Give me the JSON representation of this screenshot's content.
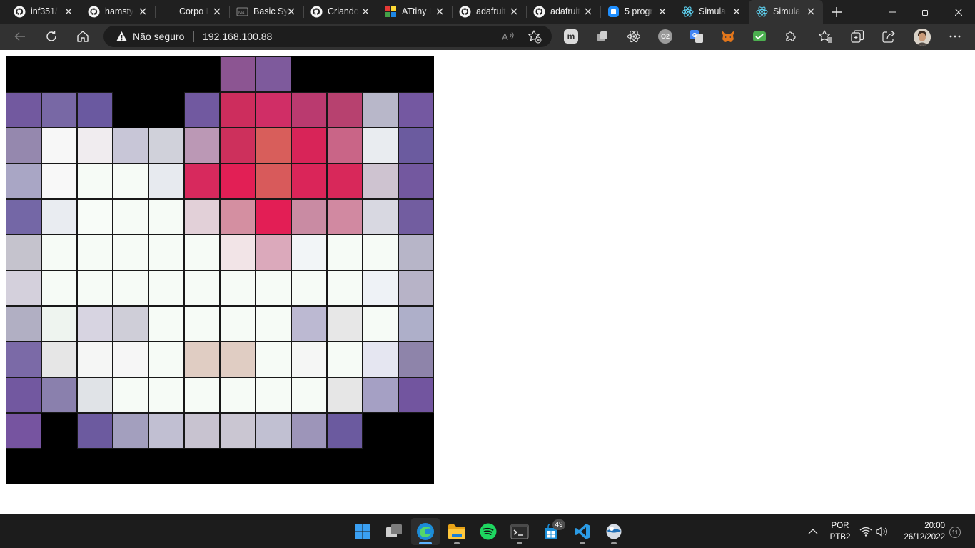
{
  "browser": {
    "tabs": [
      {
        "title": "inf351/",
        "icon": "github-icon",
        "active": false
      },
      {
        "title": "hamsty",
        "icon": "github-icon",
        "active": false
      },
      {
        "title": "Corpo I",
        "icon": "blank-page-icon",
        "active": false
      },
      {
        "title": "Basic Sy",
        "icon": "tinkercad-icon",
        "active": false
      },
      {
        "title": "Criando",
        "icon": "github-icon",
        "active": false
      },
      {
        "title": "ATtiny I",
        "icon": "attiny-icon",
        "active": false
      },
      {
        "title": "adafruit",
        "icon": "github-icon",
        "active": false
      },
      {
        "title": "adafruit",
        "icon": "github-icon",
        "active": false
      },
      {
        "title": "5 progr",
        "icon": "microsoft-icon",
        "active": false
      },
      {
        "title": "Simula",
        "icon": "react-icon",
        "active": false
      },
      {
        "title": "Simula",
        "icon": "react-icon",
        "active": true
      }
    ],
    "new_tab_icon": "plus-icon",
    "window_controls": [
      "minimize-icon",
      "restore-icon",
      "close-icon"
    ],
    "nav": {
      "back": "back-arrow-icon",
      "reload": "reload-icon",
      "home": "home-icon"
    },
    "address": {
      "security_icon": "warning-triangle-icon",
      "security_label": "Não seguro",
      "url": "192.168.100.88",
      "read_aloud_icon": "read-aloud-icon",
      "favorite_add_icon": "add-favorite-icon"
    },
    "extensions": [
      "mastodon-icon",
      "collections-ext-icon",
      "react-devtools-icon",
      "o2-icon",
      "google-translate-icon",
      "metamask-icon",
      "check-ext-icon",
      "extensions-puzzle-icon"
    ],
    "right_toolbar": [
      "favorites-icon",
      "collections-icon",
      "share-icon",
      "profile-avatar",
      "more-menu-icon"
    ]
  },
  "led_matrix": {
    "cols": 12,
    "rows": 12,
    "off_color": "#000000",
    "pixels": [
      [
        "#000000",
        "#000000",
        "#000000",
        "#000000",
        "#000000",
        "#000000",
        "#8c5592",
        "#7e5a9c",
        "#000000",
        "#000000",
        "#000000",
        "#000000"
      ],
      [
        "#72599f",
        "#7868a5",
        "#6a59a0",
        "#000000",
        "#000000",
        "#7159a0",
        "#cd2d5d",
        "#d02e66",
        "#ba3a6f",
        "#b7416f",
        "#b8b7c9",
        "#7458a1"
      ],
      [
        "#9588ae",
        "#f7f7f7",
        "#f0ecef",
        "#c8c6d7",
        "#d0d1da",
        "#bb98b5",
        "#cd305c",
        "#d85e5b",
        "#d82458",
        "#c96587",
        "#e9ecf0",
        "#6b5b9f"
      ],
      [
        "#a9a6c5",
        "#f8f8f8",
        "#f6fbf6",
        "#f6fbf6",
        "#e7eaef",
        "#d7295d",
        "#e21f55",
        "#d85a5b",
        "#da2559",
        "#d8285a",
        "#cec3d0",
        "#73589f"
      ],
      [
        "#7467a6",
        "#e9ecf1",
        "#f8fcf8",
        "#f6fbf6",
        "#f6fbf6",
        "#e2d0d8",
        "#d48fa1",
        "#e31e55",
        "#c98ba3",
        "#d189a1",
        "#d8d8e1",
        "#725da0"
      ],
      [
        "#c5c3cd",
        "#f6fbf6",
        "#f6fbf6",
        "#f6fbf6",
        "#f6fbf6",
        "#f6fbf6",
        "#f2e4e7",
        "#dba9bb",
        "#f2f5f7",
        "#f6fbf6",
        "#f6fbf6",
        "#b7b5c8"
      ],
      [
        "#d4d0dc",
        "#f6fbf6",
        "#f6fbf6",
        "#f6fbf6",
        "#f6fbf6",
        "#f6fbf6",
        "#f6fbf6",
        "#f6fbf6",
        "#f6fbf6",
        "#f6fbf6",
        "#eef2f6",
        "#b7b3c7"
      ],
      [
        "#b1afc3",
        "#eef4ef",
        "#d7d4e1",
        "#cfced8",
        "#f6fbf6",
        "#f6fbf6",
        "#f6fbf6",
        "#f6fbf6",
        "#bcb9d2",
        "#e7e7e7",
        "#f6fbf6",
        "#aeafc9"
      ],
      [
        "#7b6aa7",
        "#e6e6e6",
        "#f5f6f5",
        "#f6f6f6",
        "#f6fbf6",
        "#e0cdc3",
        "#e0cdc3",
        "#f6fbf6",
        "#f5f6f5",
        "#f6fbf6",
        "#e5e6f1",
        "#8e84aa"
      ],
      [
        "#7258a0",
        "#8a80ad",
        "#e0e3e7",
        "#f6fbf6",
        "#f6fbf6",
        "#f6fbf6",
        "#f6fbf6",
        "#f6fbf6",
        "#f6fbf6",
        "#e6e6e6",
        "#a5a0c4",
        "#72559f"
      ],
      [
        "#7654a0",
        "#000000",
        "#6c5a9f",
        "#a39fbe",
        "#c1bfd2",
        "#c8c3d0",
        "#cac6d2",
        "#c1c0d2",
        "#9d95b9",
        "#6b5a9f",
        "#000000",
        "#000000"
      ],
      [
        "#000000",
        "#000000",
        "#000000",
        "#000000",
        "#000000",
        "#000000",
        "#000000",
        "#000000",
        "#000000",
        "#000000",
        "#000000",
        "#000000"
      ]
    ]
  },
  "taskbar": {
    "apps": [
      "windows-start-icon",
      "task-view-icon",
      "edge-browser-icon",
      "file-explorer-icon",
      "spotify-icon",
      "terminal-icon",
      "microsoft-store-icon",
      "vscode-icon",
      "sphere-app-icon"
    ],
    "store_badge": "49",
    "tray": {
      "language_line1": "POR",
      "language_line2": "PTB2",
      "time": "20:00",
      "date": "26/12/2022",
      "notification_count": "11"
    }
  }
}
